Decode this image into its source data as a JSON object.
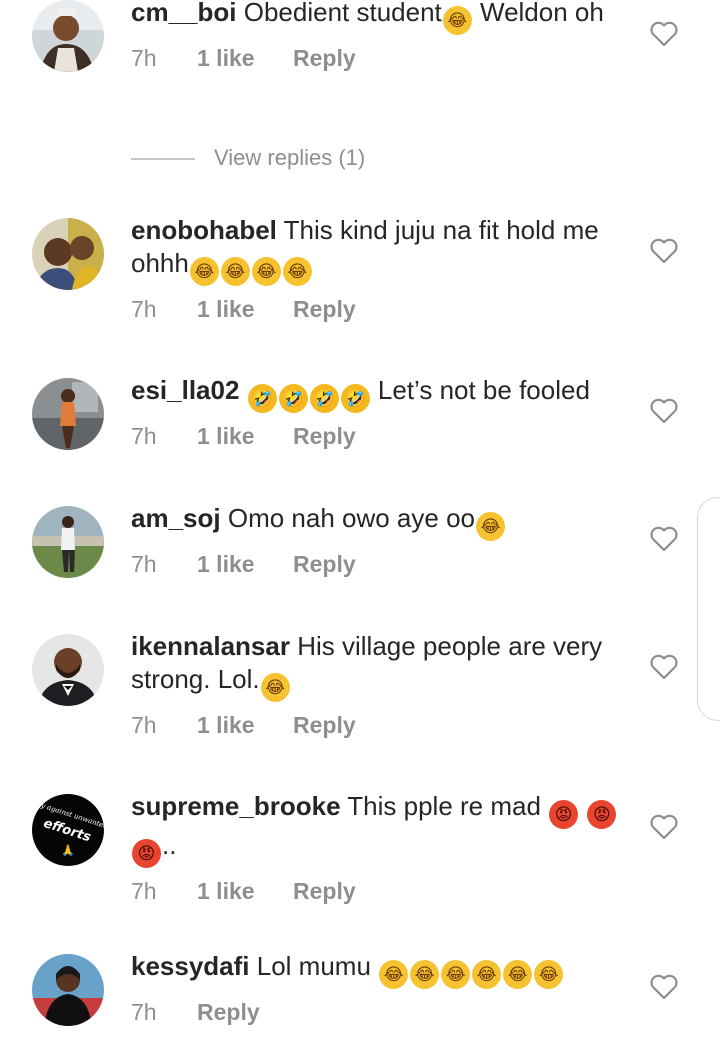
{
  "icons": {
    "heart": "heart-outline-icon",
    "emoji_joy": "face-with-tears-of-joy",
    "emoji_rofl": "rolling-on-floor-laughing",
    "emoji_angry": "angry-face"
  },
  "colors": {
    "username": "#262626",
    "meta": "#8e8e8e",
    "background": "#ffffff"
  },
  "comments": [
    {
      "username": "cm__boi",
      "before": "Obedient student",
      "emojis1": [
        "😂"
      ],
      "after": " Weldon oh",
      "emojis2": [],
      "tail": "",
      "time": "7h",
      "likes": "1 like",
      "reply": "Reply",
      "view_replies": "View replies (1)"
    },
    {
      "username": "enobohabel",
      "before": "This kind juju na fit hold me ohhh",
      "emojis1": [
        "😂",
        "😂",
        "😂",
        "😂"
      ],
      "after": "",
      "emojis2": [],
      "tail": "",
      "time": "7h",
      "likes": "1 like",
      "reply": "Reply"
    },
    {
      "username": "esi_lla02",
      "before": "",
      "emojis1": [
        "🤣",
        "🤣",
        "🤣",
        "🤣"
      ],
      "after": " Let’s not be fooled",
      "emojis2": [],
      "tail": "",
      "time": "7h",
      "likes": "1 like",
      "reply": "Reply"
    },
    {
      "username": "am_soj",
      "before": "Omo nah owo aye oo",
      "emojis1": [
        "😂"
      ],
      "after": "",
      "emojis2": [],
      "tail": "",
      "time": "7h",
      "likes": "1 like",
      "reply": "Reply"
    },
    {
      "username": "ikennalansar",
      "before": "His village people are very strong. Lol.",
      "emojis1": [
        "😂"
      ],
      "after": "",
      "emojis2": [],
      "tail": "",
      "time": "7h",
      "likes": "1 like",
      "reply": "Reply"
    },
    {
      "username": "supreme_brooke",
      "before": "This pple re mad ",
      "emojis1": [
        "😡"
      ],
      "after": " ",
      "emojis2": [
        "😡",
        "😡"
      ],
      "tail": "..",
      "time": "7h",
      "likes": "1 like",
      "reply": "Reply"
    },
    {
      "username": "kessydafi",
      "before": "Lol mumu ",
      "emojis1": [
        "😂",
        "😂",
        "😂",
        "😂",
        "😂",
        "😂"
      ],
      "after": "",
      "emojis2": [],
      "tail": "",
      "time": "7h",
      "likes": "",
      "reply": "Reply"
    }
  ],
  "avatar6_text": [
    "Pray against unwanted",
    "efforts"
  ]
}
